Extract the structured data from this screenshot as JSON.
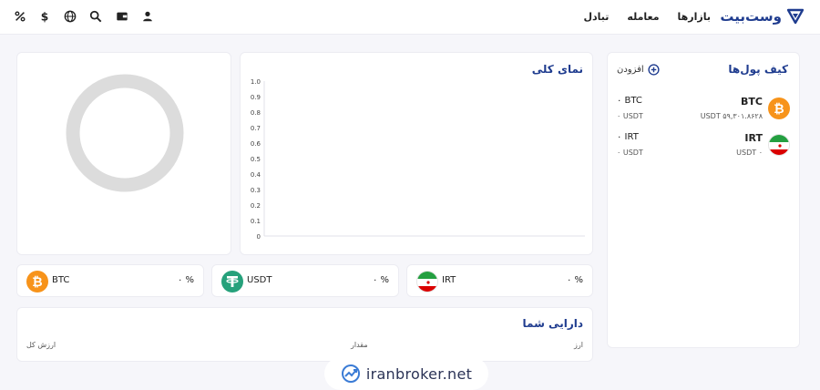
{
  "header": {
    "brand": "وست‌بیت",
    "nav": [
      "بازارها",
      "معامله",
      "تبادل"
    ],
    "icons": [
      "percent-icon",
      "dollar-icon",
      "globe-icon",
      "search-icon",
      "wallet-icon",
      "user-icon"
    ]
  },
  "wallets": {
    "title": "کیف پول‌ها",
    "add_label": "افزودن",
    "items": [
      {
        "name": "BTC",
        "sub": "USDT ۵۹,۳۰۱.۸۶۲۸",
        "amount": "۰ BTC",
        "usdt": "۰ USDT",
        "coin": "bitcoin"
      },
      {
        "name": "IRT",
        "sub": "USDT ۰",
        "amount": "۰ IRT",
        "usdt": "۰ USDT",
        "coin": "iran-flag"
      }
    ]
  },
  "overview": {
    "title": "نمای کلی",
    "chart_data": {
      "type": "line",
      "title": "",
      "xlabel": "",
      "ylabel": "",
      "ylim": [
        0,
        1.0
      ],
      "y_ticks": [
        "0",
        "0.1",
        "0.2",
        "0.3",
        "0.4",
        "0.5",
        "0.6",
        "0.7",
        "0.8",
        "0.9",
        "1.0"
      ],
      "series": []
    }
  },
  "assets": [
    {
      "name": "BTC",
      "pct": "۰ %",
      "coin": "bitcoin",
      "color": "#f7931a"
    },
    {
      "name": "USDT",
      "pct": "۰ %",
      "coin": "tether",
      "color": "#26a17b"
    },
    {
      "name": "IRT",
      "pct": "۰ %",
      "coin": "iran-flag",
      "color": "#239f40"
    }
  ],
  "holdings": {
    "title": "دارایی شما",
    "columns": [
      "ارز",
      "مقدار",
      "ارزش کل"
    ]
  },
  "watermark": {
    "text": "iranbroker.net"
  },
  "colors": {
    "brand": "#1f3c8f",
    "bitcoin": "#f7931a",
    "tether": "#26a17b",
    "donut": "#dcdcdc"
  }
}
